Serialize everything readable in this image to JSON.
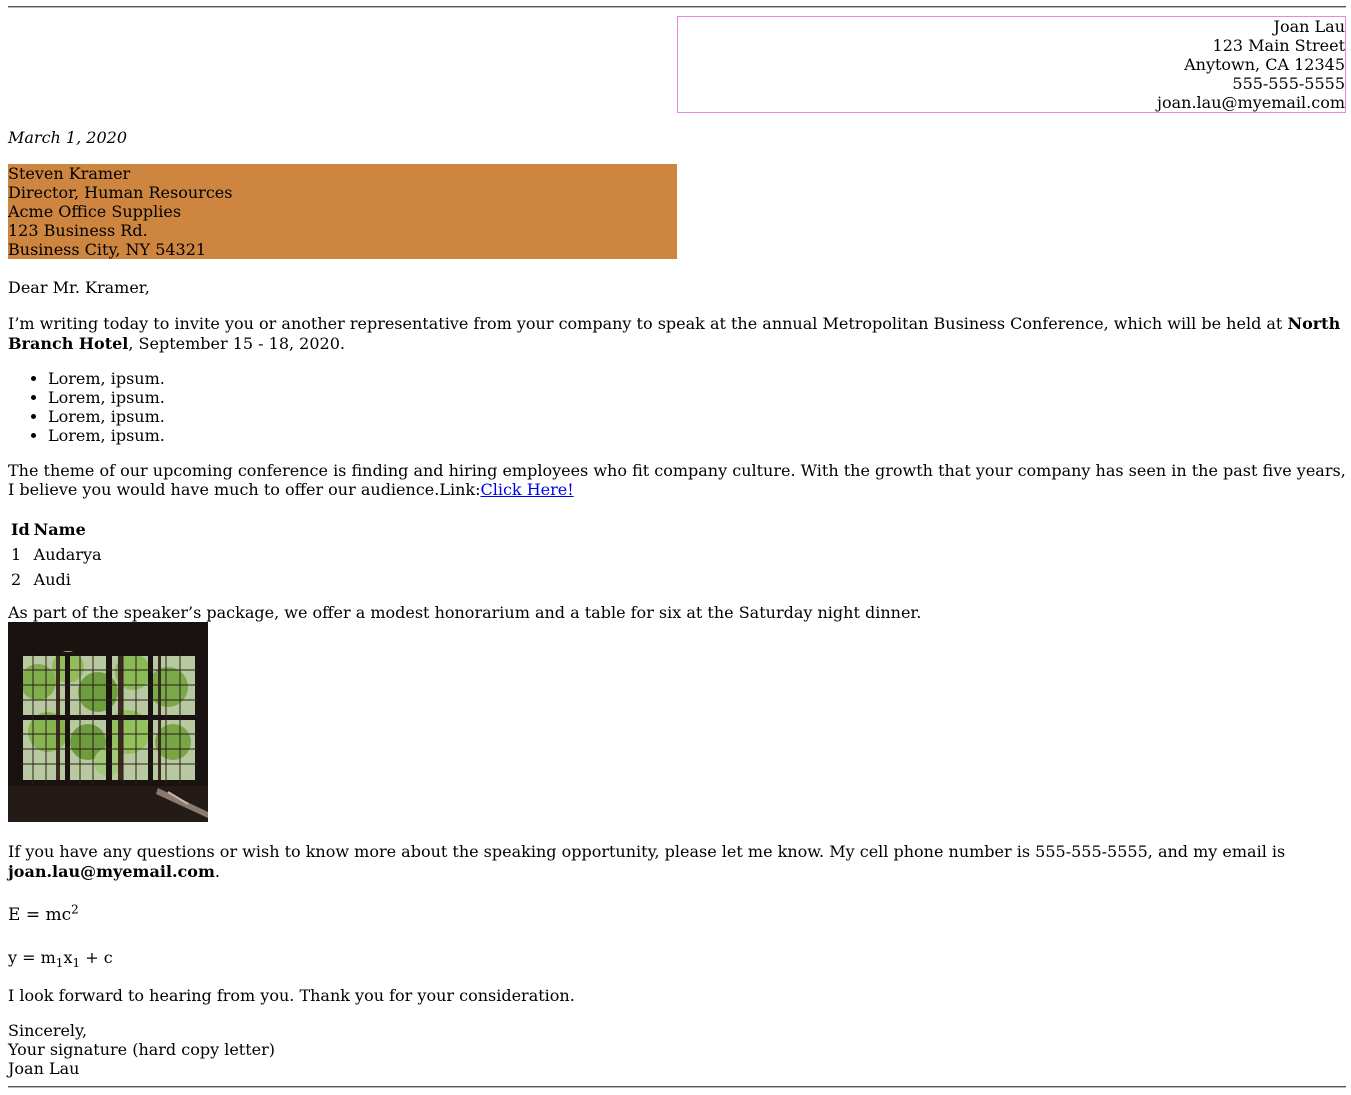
{
  "sender": {
    "name": "Joan Lau",
    "street": "123 Main Street",
    "city": "Anytown, CA 12345",
    "phone": "555-555-5555",
    "email": "joan.lau@myemail.com"
  },
  "date": "March 1, 2020",
  "recipient": {
    "name": "Steven Kramer",
    "title": "Director, Human Resources",
    "company": "Acme Office Supplies",
    "street": "123 Business Rd.",
    "city": "Business City, NY 54321"
  },
  "colors": {
    "recipient_bg": "#cd853f",
    "sender_border": "#e08be0",
    "link": "#0000ee"
  },
  "greeting": "Dear Mr. Kramer,",
  "para1": {
    "before": "I’m writing today to invite you or another representative from your company to speak at the annual Metropolitan Business Conference, which will be held at ",
    "bold": "North Branch Hotel",
    "after": ", September 15 - 18, 2020."
  },
  "list_items": [
    "Lorem, ipsum.",
    "Lorem, ipsum.",
    "Lorem, ipsum.",
    "Lorem, ipsum."
  ],
  "para2": {
    "text": "The theme of our upcoming conference is finding and hiring employees who fit company culture. With the growth that your company has seen in the past five years, I believe you would have much to offer our audience.Link:",
    "link_text": "Click Here!"
  },
  "table": {
    "headers": [
      "Id",
      "Name"
    ],
    "rows": [
      [
        "1",
        "Audarya"
      ],
      [
        "2",
        "Audi"
      ]
    ]
  },
  "para3": "As part of the speaker’s package, we offer a modest honorarium and a table for six at the Saturday night dinner.",
  "para4": {
    "text": "If you have any questions or wish to know more about the speaking opportunity, please let me know. My cell phone number is 555-555-5555, and my email is ",
    "bold": "joan.lau@myemail.com",
    "after": "."
  },
  "eq1": {
    "base": "E = mc",
    "sup": "2"
  },
  "eq2": {
    "y": "y = m",
    "sub1": "1",
    "x": "x",
    "sub2": "1",
    "rest": " + c"
  },
  "closing_line": "I look forward to hearing from you. Thank you for your consideration.",
  "signoff": {
    "sincerely": "Sincerely,",
    "signature": "Your signature (hard copy letter)",
    "name": "Joan Lau"
  }
}
